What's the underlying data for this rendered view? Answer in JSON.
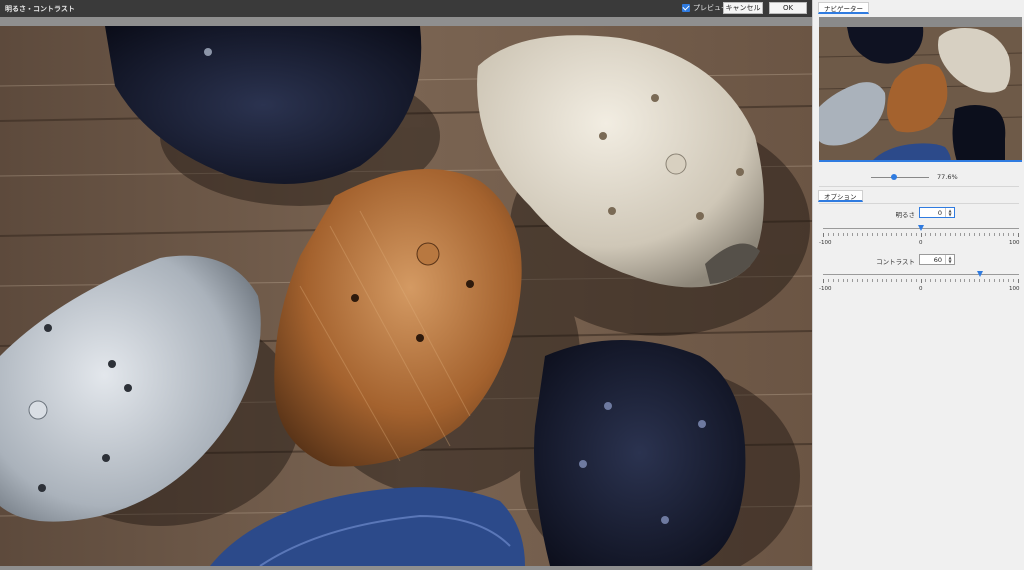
{
  "window": {
    "title": "明るさ・コントラスト",
    "preview_label": "プレビュー",
    "preview_checked": true,
    "cancel_label": "キャンセル",
    "ok_label": "OK"
  },
  "navigator": {
    "tab_label": "ナビゲーター",
    "zoom_text": "77.6%",
    "zoom_percent": 77.6
  },
  "options": {
    "tab_label": "オプション",
    "brightness": {
      "label": "明るさ",
      "value": "0",
      "min_label": "-100",
      "mid_label": "0",
      "max_label": "100",
      "level": 0
    },
    "contrast": {
      "label": "コントラスト",
      "value": "60",
      "min_label": "-100",
      "mid_label": "0",
      "max_label": "100",
      "level": 60
    }
  },
  "colors": {
    "accent": "#2f7be0",
    "titlebar": "#3a3a3a",
    "panel": "#f0f0f0"
  }
}
